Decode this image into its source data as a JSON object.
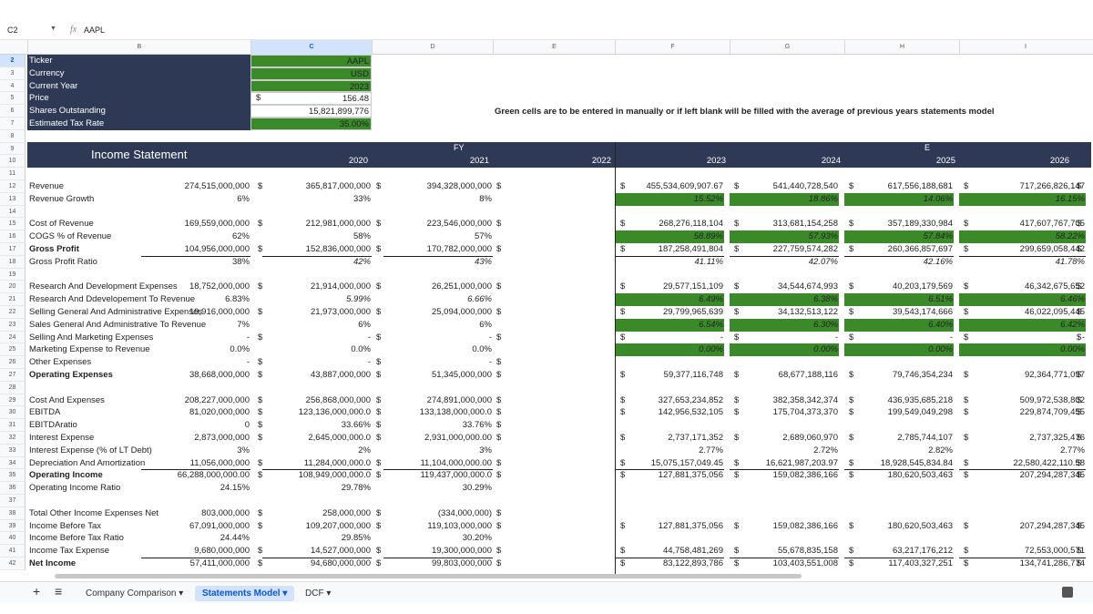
{
  "formula": {
    "cell": "C2",
    "fx": "fx",
    "value": "AAPL"
  },
  "cols": [
    "B",
    "C",
    "D",
    "E",
    "F",
    "G",
    "H",
    "I"
  ],
  "top_rows": [
    {
      "n": "2",
      "label": "Ticker",
      "value": "AAPL"
    },
    {
      "n": "3",
      "label": "Currency",
      "value": "USD"
    },
    {
      "n": "4",
      "label": "Current Year",
      "value": "2023"
    },
    {
      "n": "5",
      "label": "Price",
      "value": "156.48",
      "dollar": "$"
    },
    {
      "n": "6",
      "label": "Shares Outstanding",
      "value": "15,821,899,776"
    },
    {
      "n": "7",
      "label": "Estimated Tax Rate",
      "value": "35.00%"
    }
  ],
  "note": "Green cells are to be entered in manually or if left blank will be filled with the average of previous years statements model",
  "section": {
    "title": "Income Statement",
    "fy": "FY",
    "e": "E",
    "years": [
      "2020",
      "2021",
      "2022",
      "2023",
      "2024",
      "2025",
      "2026"
    ]
  },
  "rows": [
    {
      "n": "11",
      "label": "",
      "vals": []
    },
    {
      "n": "12",
      "label": "Revenue",
      "vals": [
        "274,515,000,000",
        "365,817,000,000",
        "394,328,000,000",
        "455,534,609,907.67",
        "541,440,728,540",
        "617,556,188,681",
        "717,266,826,147"
      ],
      "dollar": true
    },
    {
      "n": "13",
      "label": "Revenue Growth",
      "vals": [
        "6%",
        "33%",
        "8%",
        "15.52%",
        "18.86%",
        "14.06%",
        "16.15%"
      ],
      "green": true
    },
    {
      "n": "14",
      "label": "",
      "vals": []
    },
    {
      "n": "15",
      "label": "Cost of Revenue",
      "vals": [
        "169,559,000,000",
        "212,981,000,000",
        "223,546,000,000",
        "268,276,118,104",
        "313,681,154,258",
        "357,189,330,984",
        "417,607,767,705"
      ],
      "dollar": true
    },
    {
      "n": "16",
      "label": "COGS % of Revenue",
      "vals": [
        "62%",
        "58%",
        "57%",
        "58.89%",
        "57.93%",
        "57.84%",
        "58.22%"
      ],
      "green": true
    },
    {
      "n": "17",
      "label": "Gross Profit",
      "bold": true,
      "vals": [
        "104,956,000,000",
        "152,836,000,000",
        "170,782,000,000",
        "187,258,491,804",
        "227,759,574,282",
        "260,366,857,697",
        "299,659,058,442"
      ],
      "dollar": true,
      "ul": true
    },
    {
      "n": "18",
      "label": "Gross Profit Ratio",
      "vals": [
        "38%",
        "42%",
        "43%",
        "41.11%",
        "42.07%",
        "42.16%",
        "41.78%"
      ],
      "ital": true
    },
    {
      "n": "19",
      "label": "",
      "vals": []
    },
    {
      "n": "20",
      "label": "Research And Development Expenses",
      "vals": [
        "18,752,000,000",
        "21,914,000,000",
        "26,251,000,000",
        "29,577,151,109",
        "34,544,674,993",
        "40,203,179,569",
        "46,342,675,652"
      ],
      "dollar": true
    },
    {
      "n": "21",
      "label": "Research And Ddevelopement To Revenue",
      "vals": [
        "6.83%",
        "5.99%",
        "6.66%",
        "6.49%",
        "6.38%",
        "6.51%",
        "6.46%"
      ],
      "green": true,
      "ital": true
    },
    {
      "n": "22",
      "label": "Selling General And Administrative Expenses",
      "vals": [
        "19,916,000,000",
        "21,973,000,000",
        "25,094,000,000",
        "29,799,965,639",
        "34,132,513,122",
        "39,543,174,666",
        "46,022,095,445"
      ],
      "dollar": true
    },
    {
      "n": "23",
      "label": "Sales General And Administrative To Revenue",
      "vals": [
        "7%",
        "6%",
        "6%",
        "6.54%",
        "6.30%",
        "6.40%",
        "6.42%"
      ],
      "green": true
    },
    {
      "n": "24",
      "label": "Selling And Marketing Expenses",
      "vals": [
        "-",
        "-",
        "-",
        "-",
        "-",
        "-",
        "-"
      ],
      "dollar": true
    },
    {
      "n": "25",
      "label": "Marketing Expense to Revenue",
      "vals": [
        "0.0%",
        "0.0%",
        "0.0%",
        "0.00%",
        "0.00%",
        "0.00%",
        "0.00%"
      ],
      "green": true
    },
    {
      "n": "26",
      "label": "Other Expenses",
      "vals": [
        "-",
        "-",
        "-",
        "",
        "",
        "",
        ""
      ],
      "dollar": true
    },
    {
      "n": "27",
      "label": "Operating Expenses",
      "bold": true,
      "vals": [
        "38,668,000,000",
        "43,887,000,000",
        "51,345,000,000",
        "59,377,116,748",
        "68,677,188,116",
        "79,746,354,234",
        "92,364,771,097"
      ],
      "dollar": true
    },
    {
      "n": "28",
      "label": "",
      "vals": []
    },
    {
      "n": "29",
      "label": "Cost And Expenses",
      "vals": [
        "208,227,000,000",
        "256,868,000,000",
        "274,891,000,000",
        "327,653,234,852",
        "382,358,342,374",
        "436,935,685,218",
        "509,972,538,802"
      ],
      "dollar": true
    },
    {
      "n": "30",
      "label": "EBITDA",
      "vals": [
        "81,020,000,000",
        "123,136,000,000.0",
        "133,138,000,000.0",
        "142,956,532,105",
        "175,704,373,370",
        "199,549,049,298",
        "229,874,709,455"
      ],
      "dollar": true
    },
    {
      "n": "31",
      "label": "EBITDAratio",
      "vals": [
        "0",
        "33.66%",
        "33.76%",
        "",
        "",
        "",
        ""
      ],
      "dollar": true
    },
    {
      "n": "32",
      "label": "Interest Expense",
      "vals": [
        "2,873,000,000",
        "2,645,000,000.0",
        "2,931,000,000.00",
        "2,737,171,352",
        "2,689,060,970",
        "2,785,744,107",
        "2,737,325,476"
      ],
      "dollar": true
    },
    {
      "n": "33",
      "label": "Interest Expense (% of LT Debt)",
      "vals": [
        "3%",
        "2%",
        "3%",
        "2.77%",
        "2.72%",
        "2.82%",
        "2.77%"
      ]
    },
    {
      "n": "34",
      "label": "Depreciation And Amortization",
      "vals": [
        "11,056,000,000",
        "11,284,000,000.0",
        "11,104,000,000.00",
        "15,075,157,049.45",
        "16,621,987,203.97",
        "18,928,545,834.84",
        "22,580,422,110.58"
      ],
      "dollar": true,
      "ul": true
    },
    {
      "n": "35",
      "label": "Operating Income",
      "bold": true,
      "vals": [
        "66,288,000,000.00",
        "108,949,000,000.0",
        "119,437,000,000.0",
        "127,881,375,056",
        "159,082,386,166",
        "180,620,503,463",
        "207,294,287,345"
      ],
      "dollar": true
    },
    {
      "n": "36",
      "label": "Operating Income Ratio",
      "vals": [
        "24.15%",
        "29.78%",
        "30.29%",
        "",
        "",
        "",
        ""
      ]
    },
    {
      "n": "37",
      "label": "",
      "vals": []
    },
    {
      "n": "38",
      "label": "Total Other Income Expenses Net",
      "vals": [
        "803,000,000",
        "258,000,000",
        "(334,000,000)",
        "",
        "",
        "",
        ""
      ],
      "dollar": true
    },
    {
      "n": "39",
      "label": "Income Before Tax",
      "vals": [
        "67,091,000,000",
        "109,207,000,000",
        "119,103,000,000",
        "127,881,375,056",
        "159,082,386,166",
        "180,620,503,463",
        "207,294,287,345"
      ],
      "dollar": true
    },
    {
      "n": "40",
      "label": "Income Before Tax Ratio",
      "vals": [
        "24.44%",
        "29.85%",
        "30.20%",
        "",
        "",
        "",
        ""
      ]
    },
    {
      "n": "41",
      "label": "Income Tax Expense",
      "vals": [
        "9,680,000,000",
        "14,527,000,000",
        "19,300,000,000",
        "44,758,481,269",
        "55,678,835,158",
        "63,217,176,212",
        "72,553,000,571"
      ],
      "dollar": true,
      "ul": true
    },
    {
      "n": "42",
      "label": "Net Income",
      "bold": true,
      "vals": [
        "57,411,000,000",
        "94,680,000,000",
        "99,803,000,000",
        "83,122,893,786",
        "103,403,551,008",
        "117,403,327,251",
        "134,741,286,774"
      ],
      "dollar": true
    }
  ],
  "rownums_misc": [
    "8",
    "9",
    "10"
  ],
  "tabs": {
    "add": "+",
    "menu": "≡",
    "items": [
      "Company Comparison",
      "Statements Model",
      "DCF"
    ],
    "active": 1
  },
  "colors": {
    "green": "#3a8a2a",
    "header": "#2e3a55",
    "select": "#d3e3fd"
  }
}
